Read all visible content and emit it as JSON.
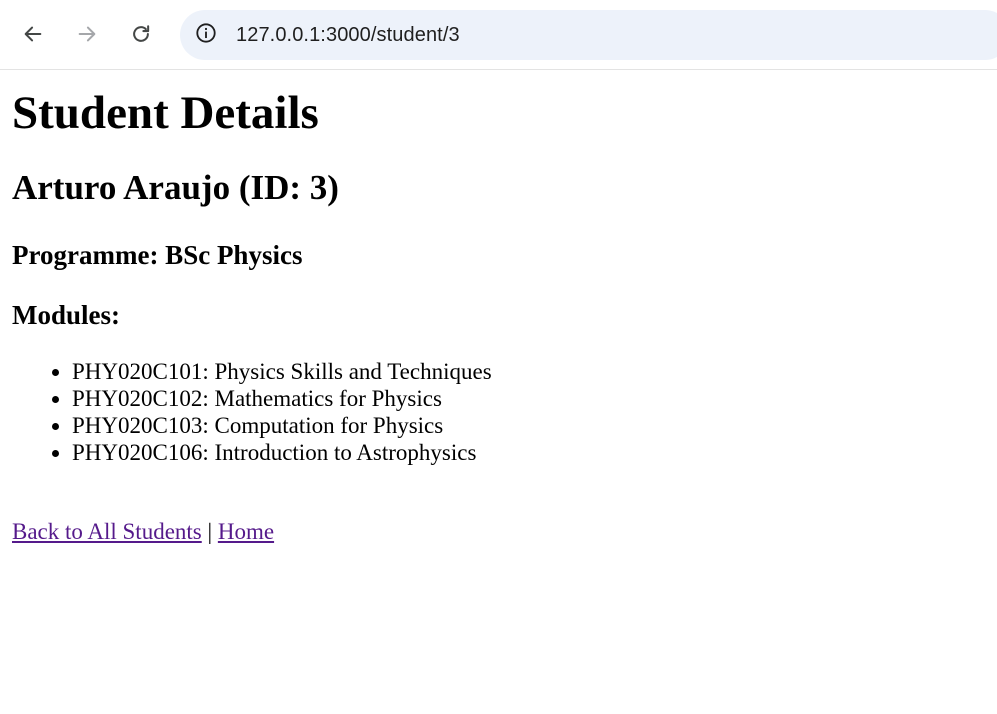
{
  "browser": {
    "url": "127.0.0.1:3000/student/3",
    "icons": {
      "back": "arrow-left-icon",
      "forward": "arrow-right-icon",
      "reload": "reload-icon",
      "site_info": "info-icon"
    }
  },
  "page": {
    "title": "Student Details",
    "student_heading": "Arturo Araujo (ID: 3)",
    "programme": "Programme: BSc Physics",
    "modules_heading": "Modules:",
    "modules": [
      "PHY020C101: Physics Skills and Techniques",
      "PHY020C102: Mathematics for Physics",
      "PHY020C103: Computation for Physics",
      "PHY020C106: Introduction to Astrophysics"
    ],
    "links": {
      "back_label": "Back to All Students",
      "separator": " | ",
      "home_label": "Home"
    }
  },
  "colors": {
    "visited_link": "#551a8b",
    "omnibox_bg": "#edf2fa"
  }
}
